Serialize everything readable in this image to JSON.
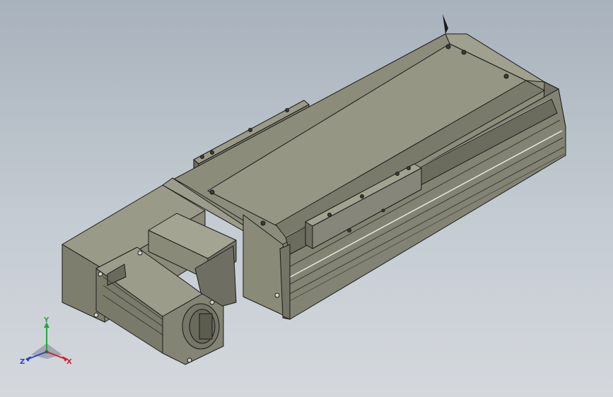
{
  "triad": {
    "x_label": "X",
    "y_label": "Y",
    "z_label": "Z",
    "x_color": "#d4202a",
    "y_color": "#22a83a",
    "z_color": "#2844c8"
  },
  "scene": {
    "background_top": "#a8b2bc",
    "background_bottom": "#d4d8dd",
    "part_color": "#8e8e7c",
    "edge_color": "#1a1a1a"
  }
}
